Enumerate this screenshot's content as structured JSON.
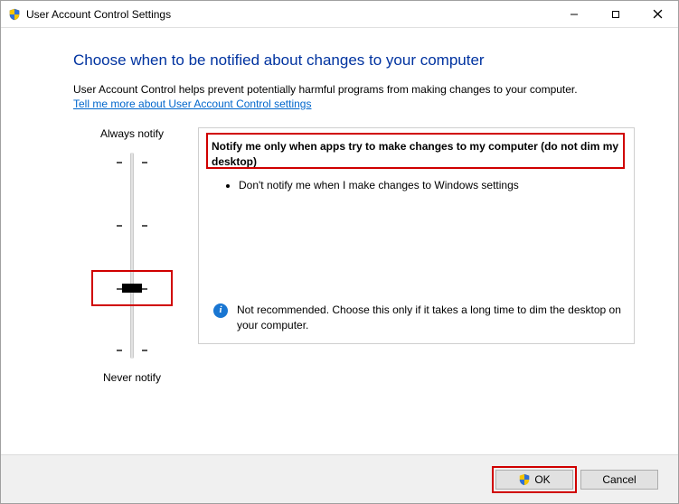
{
  "window": {
    "title": "User Account Control Settings"
  },
  "page": {
    "heading": "Choose when to be notified about changes to your computer",
    "intro": "User Account Control helps prevent potentially harmful programs from making changes to your computer.",
    "help_link": "Tell me more about User Account Control settings"
  },
  "slider": {
    "top_label": "Always notify",
    "bottom_label": "Never notify",
    "steps": 4,
    "selected_index": 2
  },
  "info": {
    "heading": "Notify me only when apps try to make changes to my computer (do not dim my desktop)",
    "bullets": [
      "Don't notify me when I make changes to Windows settings"
    ],
    "footer": "Not recommended. Choose this only if it takes a long time to dim the desktop on your computer."
  },
  "buttons": {
    "ok": "OK",
    "cancel": "Cancel"
  }
}
